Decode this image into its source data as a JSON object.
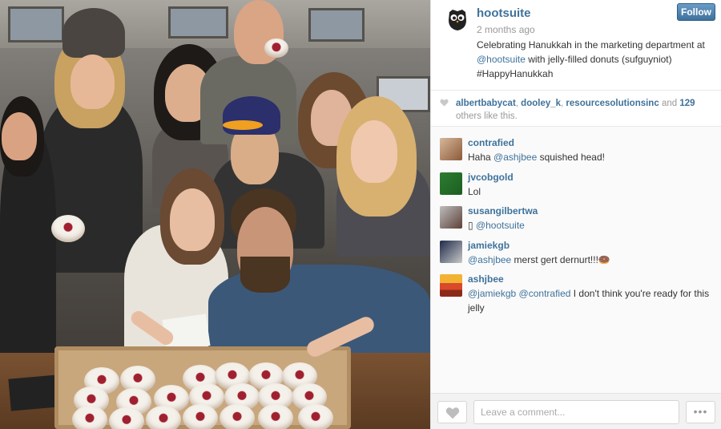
{
  "post": {
    "username": "hootsuite",
    "follow_label": "Follow",
    "time_ago": "2 months ago",
    "caption": {
      "before": "Celebrating Hanukkah in the marketing department at ",
      "mention": "@hootsuite",
      "after": " with jelly-filled donuts (sufguyniot) #HappyHanukkah"
    },
    "icons": {
      "avatar": "owl-logo-icon",
      "heart": "heart-icon",
      "more": "more-options-icon"
    },
    "accent_color": "#3f729b"
  },
  "likes": {
    "users": [
      "albertbabycat",
      "dooley_k",
      "resourcesolutionsinc"
    ],
    "and_label": "and",
    "others_count": "129",
    "suffix": "others like this."
  },
  "comments": [
    {
      "author": "contrafied",
      "before": "Haha ",
      "mention": "@ashjbee",
      "after": " squished head!"
    },
    {
      "author": "jvcobgold",
      "before": "Lol",
      "mention": "",
      "after": ""
    },
    {
      "author": "susangilbertwa",
      "before": "▯ ",
      "mention": "@hootsuite",
      "after": ""
    },
    {
      "author": "jamiekgb",
      "before": "",
      "mention": "@ashjbee",
      "after": " merst gert dernurt!!!🍩"
    },
    {
      "author": "ashjbee",
      "before": "",
      "mention": "@jamiekgb @contrafied",
      "after": " I don't think you're ready for this jelly"
    }
  ],
  "footer": {
    "comment_placeholder": "Leave a comment...",
    "more_label": "•••"
  }
}
